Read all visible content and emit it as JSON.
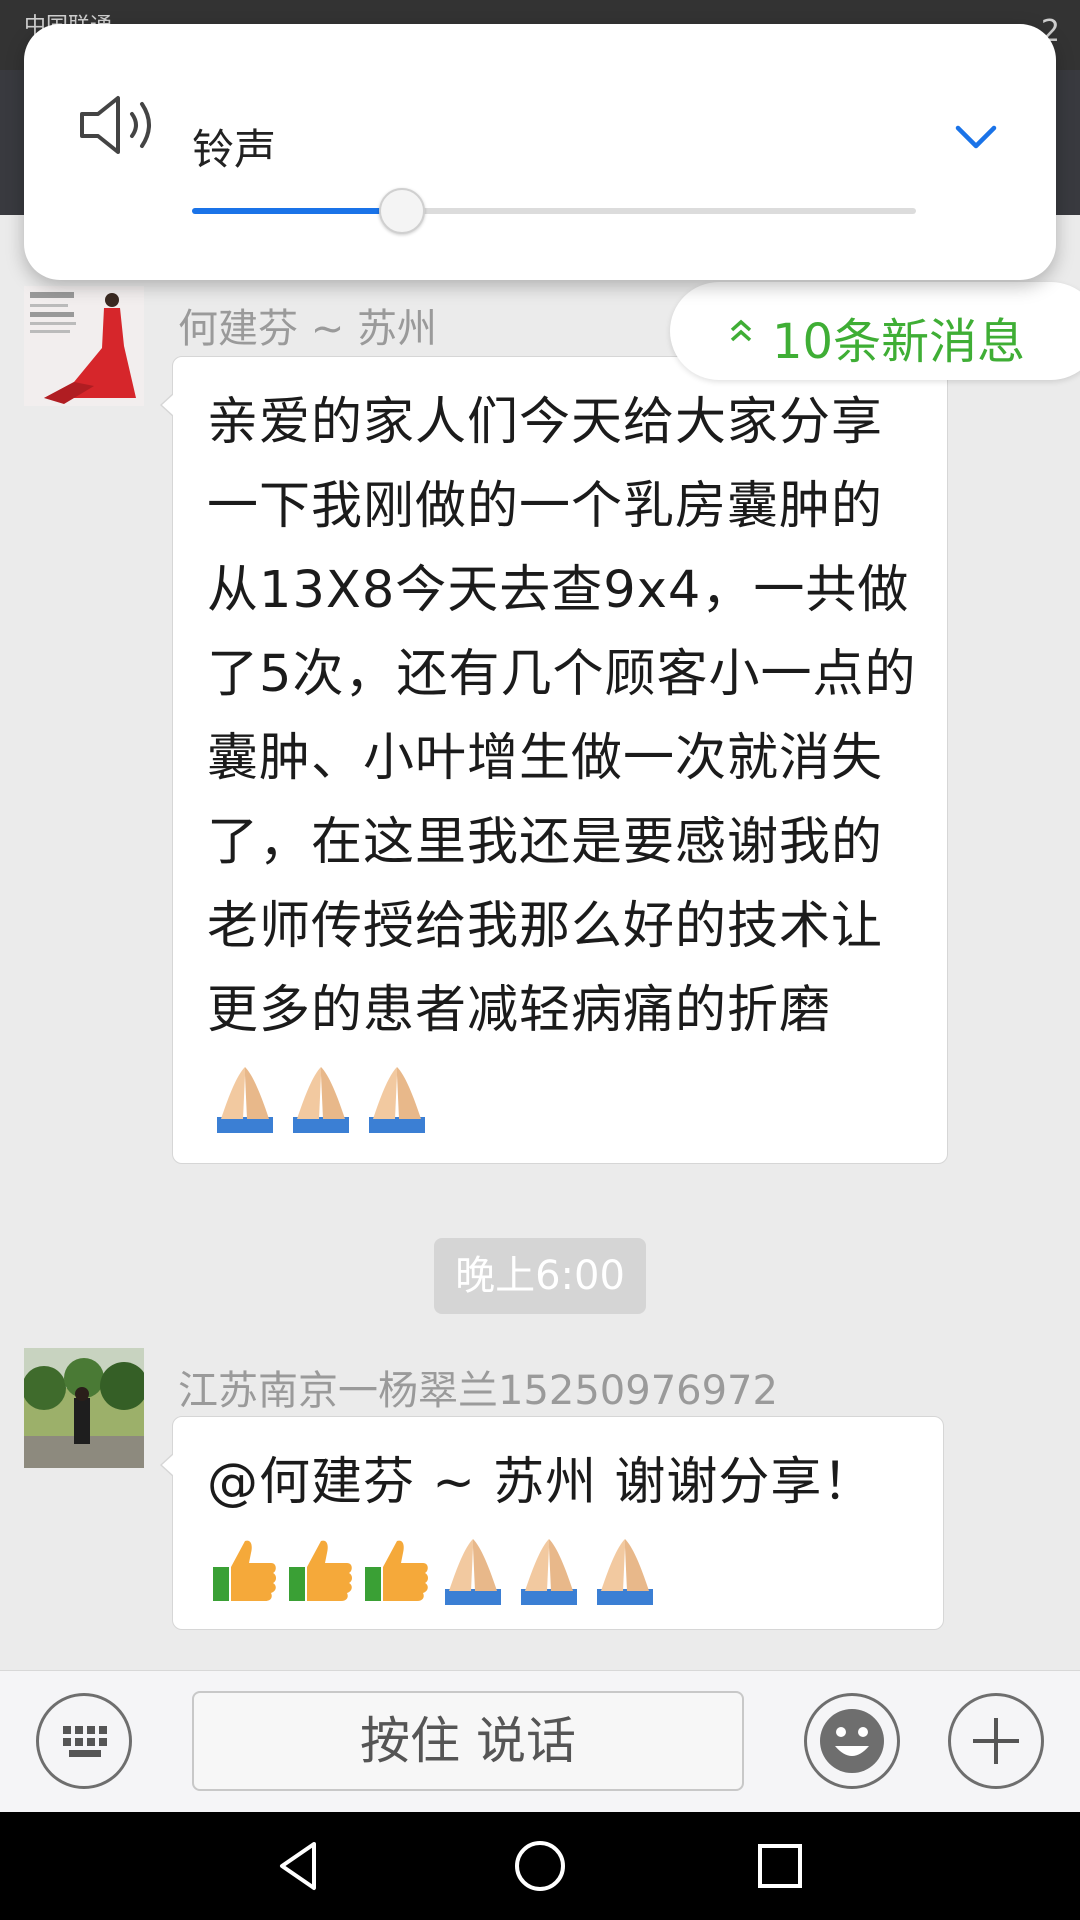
{
  "status_bar": {
    "carrier": "中国联通",
    "time": "2"
  },
  "volume_panel": {
    "label": "铃声",
    "level_percent": 29
  },
  "new_messages": {
    "label": "10条新消息"
  },
  "messages": [
    {
      "sender": "何建芬 ~ 苏州",
      "text": "亲爱的家人们今天给大家分享一下我刚做的一个乳房囊肿的从13X8今天去查9x4，一共做了5次，还有几个顾客小一点的囊肿、小叶增生做一次就消失了，在这里我还是要感谢我的老师传授给我那么好的技术让更多的患者减轻病痛的折磨",
      "emojis": [
        "folded-hands",
        "folded-hands",
        "folded-hands"
      ]
    },
    {
      "sender": "江苏南京一杨翠兰15250976972",
      "text": "@何建芬 ~ 苏州 谢谢分享！",
      "emojis": [
        "thumbs-up",
        "thumbs-up",
        "thumbs-up",
        "folded-hands",
        "folded-hands",
        "folded-hands"
      ]
    }
  ],
  "time_divider": "晚上6:00",
  "input_bar": {
    "hold_to_talk": "按住 说话"
  },
  "colors": {
    "accent_blue": "#1a73e8",
    "new_msg_green": "#3fae35",
    "chat_bg": "#ebebeb"
  }
}
